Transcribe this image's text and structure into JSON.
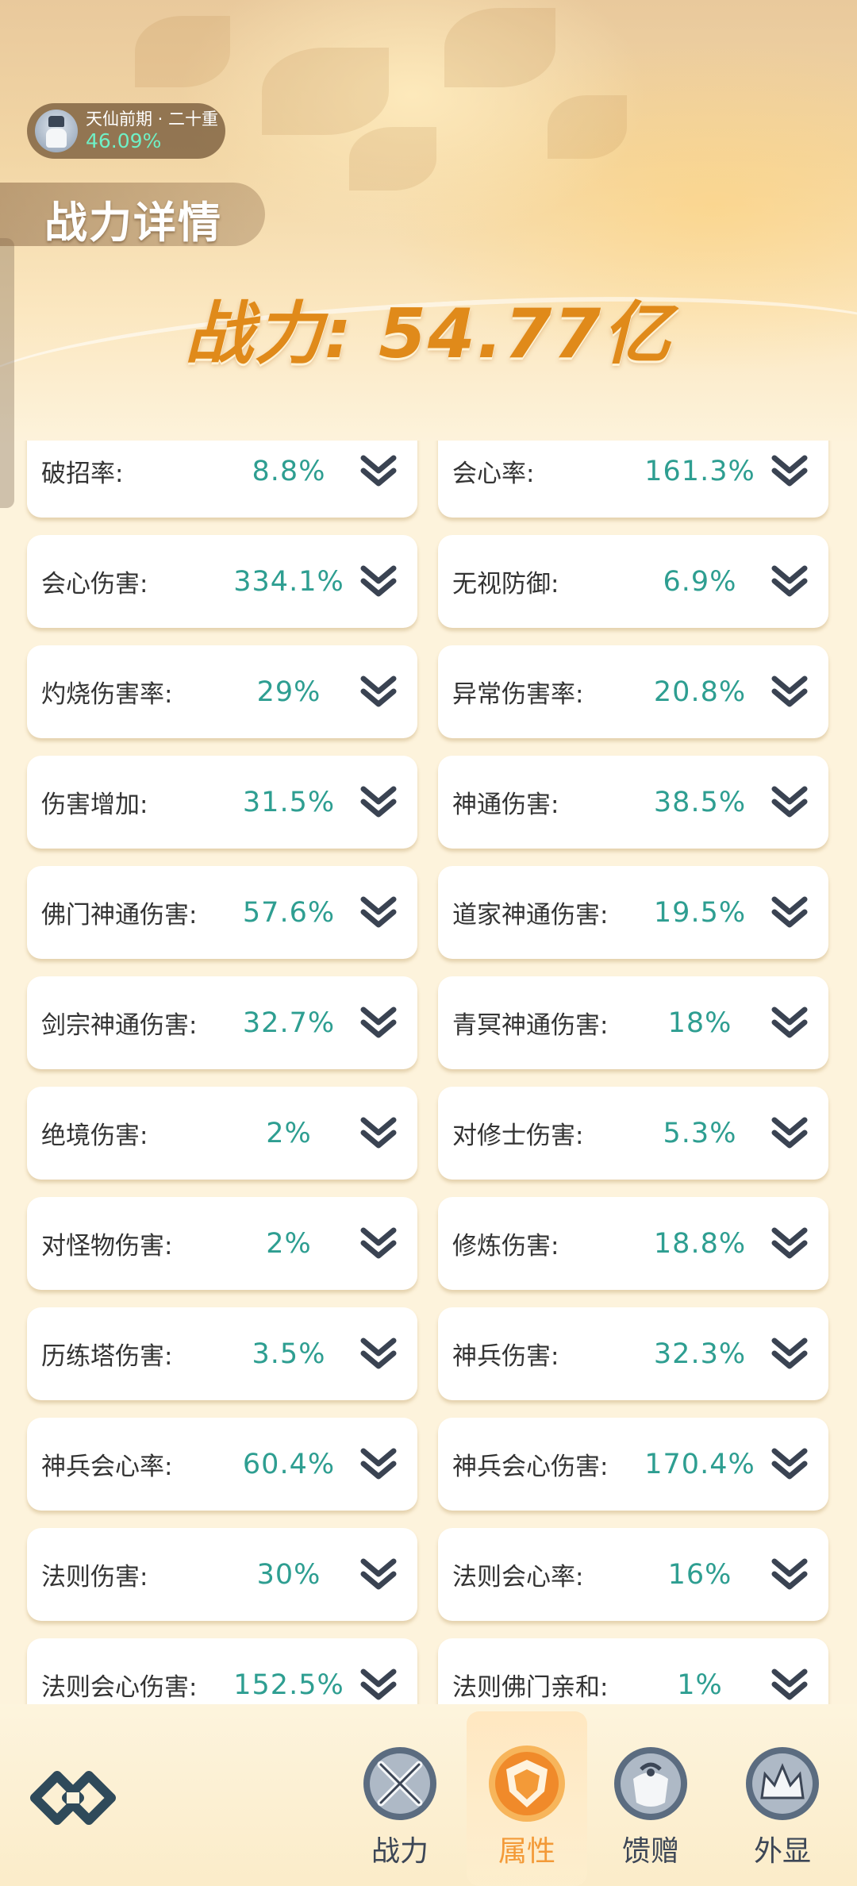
{
  "realm": {
    "name": "天仙前期 · 二十重",
    "progress": "46.09%"
  },
  "title": "战力详情",
  "power": "战力: 54.77亿",
  "stats": [
    {
      "label": "破招率:",
      "value": "8.8%"
    },
    {
      "label": "会心率:",
      "value": "161.3%"
    },
    {
      "label": "会心伤害:",
      "value": "334.1%"
    },
    {
      "label": "无视防御:",
      "value": "6.9%"
    },
    {
      "label": "灼烧伤害率:",
      "value": "29%"
    },
    {
      "label": "异常伤害率:",
      "value": "20.8%"
    },
    {
      "label": "伤害增加:",
      "value": "31.5%"
    },
    {
      "label": "神通伤害:",
      "value": "38.5%"
    },
    {
      "label": "佛门神通伤害:",
      "value": "57.6%"
    },
    {
      "label": "道家神通伤害:",
      "value": "19.5%"
    },
    {
      "label": "剑宗神通伤害:",
      "value": "32.7%"
    },
    {
      "label": "青冥神通伤害:",
      "value": "18%"
    },
    {
      "label": "绝境伤害:",
      "value": "2%"
    },
    {
      "label": "对修士伤害:",
      "value": "5.3%"
    },
    {
      "label": "对怪物伤害:",
      "value": "2%"
    },
    {
      "label": "修炼伤害:",
      "value": "18.8%"
    },
    {
      "label": "历练塔伤害:",
      "value": "3.5%"
    },
    {
      "label": "神兵伤害:",
      "value": "32.3%"
    },
    {
      "label": "神兵会心率:",
      "value": "60.4%"
    },
    {
      "label": "神兵会心伤害:",
      "value": "170.4%"
    },
    {
      "label": "法则伤害:",
      "value": "30%"
    },
    {
      "label": "法则会心率:",
      "value": "16%"
    },
    {
      "label": "法则会心伤害:",
      "value": "152.5%"
    },
    {
      "label": "法则佛门亲和:",
      "value": "1%"
    }
  ],
  "nav": {
    "items": [
      {
        "label": "战力",
        "icon": "swords-icon",
        "active": false
      },
      {
        "label": "属性",
        "icon": "shield-icon",
        "active": true
      },
      {
        "label": "馈赠",
        "icon": "gift-bag-icon",
        "active": false
      },
      {
        "label": "外显",
        "icon": "crown-icon",
        "active": false
      }
    ]
  },
  "colors": {
    "accent": "#e08a1a",
    "value": "#2e9e91",
    "active_tab": "#f39a38",
    "nav_icon": "#3c4656"
  }
}
